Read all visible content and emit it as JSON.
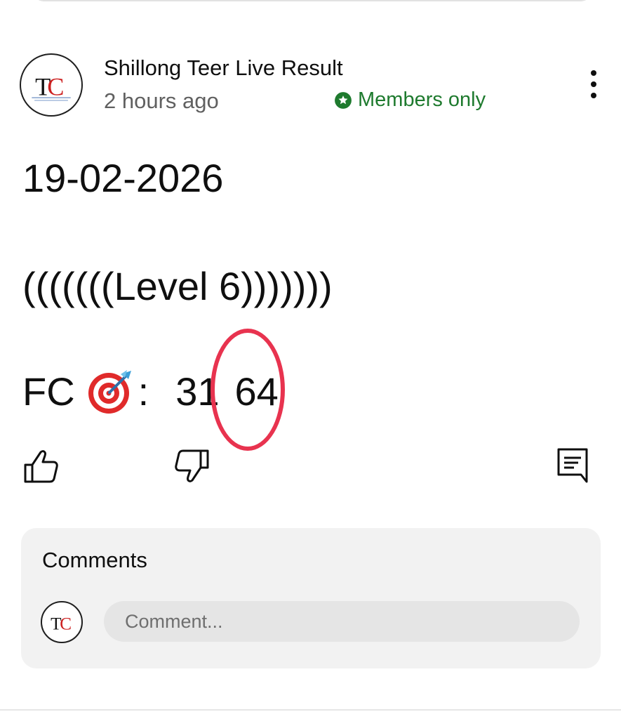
{
  "post": {
    "channel_name": "Shillong Teer Live Result",
    "time_ago": "2 hours ago",
    "members_badge": "Members only",
    "date_line": "19-02-2026",
    "level_line": "(((((((Level 6)))))))",
    "fc_label": "FC",
    "fc_colon": ":",
    "fc_first": "31",
    "fc_second": "64"
  },
  "avatar": {
    "initials_t": "T",
    "initials_c": "C"
  },
  "comments": {
    "title": "Comments",
    "placeholder": "Comment..."
  },
  "icons": {
    "menu": "three-dots-vertical-icon",
    "members_badge": "star-circle-icon",
    "fc_emoji": "direct-hit-dart-icon",
    "like": "thumbs-up-icon",
    "dislike": "thumbs-down-icon",
    "comment": "comment-icon"
  },
  "colors": {
    "members_green": "#1e7a2e",
    "highlight_red": "#e8334f",
    "secondary_text": "#606060",
    "comments_bg": "#f2f2f2"
  }
}
